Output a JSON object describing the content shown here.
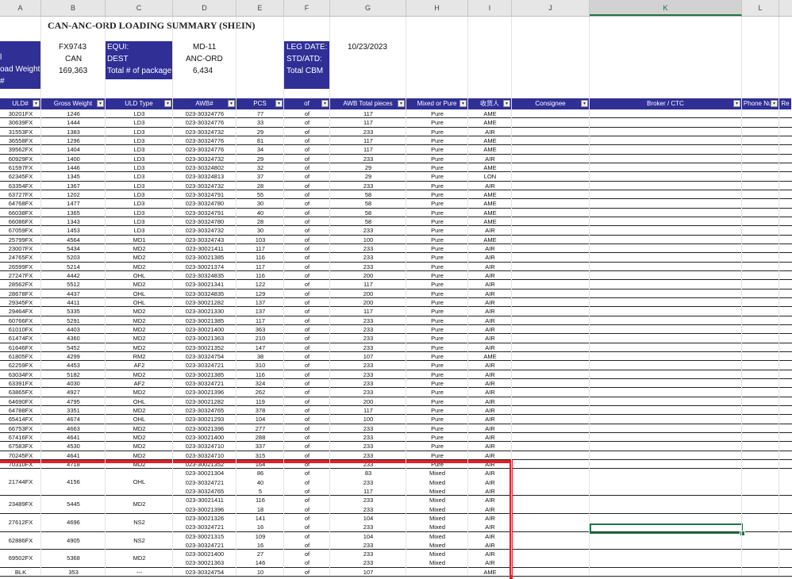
{
  "column_headers": [
    "A",
    "B",
    "C",
    "D",
    "E",
    "F",
    "G",
    "H",
    "I",
    "J",
    "K",
    "L"
  ],
  "selected_column": "K",
  "title": "CAN-ANC-ORD LOADING SUMMARY (SHEIN)",
  "header": {
    "flight": "FX9743",
    "equi_label": "EQUI:",
    "equi_value": "MD-11",
    "leg_date_label": "LEG DATE:",
    "leg_date_value": "10/23/2023",
    "origin": "CAN",
    "dest_label": "DEST",
    "dest_value": "ANC-ORD",
    "std_label": "STD/ATD:",
    "row3_label": "oad Weight:",
    "load_weight": "169,363",
    "total_pkg_label": "Total # of package",
    "total_pkg_value": "6,434",
    "total_cbm_label": "Total CBM",
    "row4_label": "#",
    "row1_label": "l"
  },
  "table_headers": [
    "ULD#",
    "Gross Weight",
    "ULD Type",
    "AWB#",
    "PCS",
    "of",
    "AWB Total pieces",
    "Mixed or Pure",
    "收货人",
    "Consignee",
    "Broker / CTC",
    "Phone Num",
    "Re"
  ],
  "rows": [
    [
      "30201FX",
      "1246",
      "LD3",
      "023-30324776",
      "77",
      "of",
      "117",
      "Pure",
      "AME"
    ],
    [
      "30639FX",
      "1444",
      "LD3",
      "023-30324776",
      "33",
      "of",
      "117",
      "Pure",
      "AME"
    ],
    [
      "31553FX",
      "1383",
      "LD3",
      "023-30324732",
      "29",
      "of",
      "233",
      "Pure",
      "AIR"
    ],
    [
      "36558FX",
      "1296",
      "LD3",
      "023-30324776",
      "81",
      "of",
      "117",
      "Pure",
      "AME"
    ],
    [
      "39562FX",
      "1404",
      "LD3",
      "023-30324776",
      "34",
      "of",
      "117",
      "Pure",
      "AME"
    ],
    [
      "60929FX",
      "1400",
      "LD3",
      "023-30324732",
      "29",
      "of",
      "233",
      "Pure",
      "AIR"
    ],
    [
      "61597FX",
      "1446",
      "LD3",
      "023-30324802",
      "32",
      "of",
      "29",
      "Pure",
      "AME"
    ],
    [
      "62345FX",
      "1345",
      "LD3",
      "023-30324813",
      "37",
      "of",
      "29",
      "Pure",
      "LON"
    ],
    [
      "63354FX",
      "1367",
      "LD3",
      "023-30324732",
      "28",
      "of",
      "233",
      "Pure",
      "AIR"
    ],
    [
      "63727FX",
      "1202",
      "LD3",
      "023-30324791",
      "55",
      "of",
      "58",
      "Pure",
      "AME"
    ],
    [
      "64768FX",
      "1477",
      "LD3",
      "023-30324780",
      "30",
      "of",
      "58",
      "Pure",
      "AME"
    ],
    [
      "66038FX",
      "1365",
      "LD3",
      "023-30324791",
      "40",
      "of",
      "58",
      "Pure",
      "AME"
    ],
    [
      "66086FX",
      "1343",
      "LD3",
      "023-30324780",
      "28",
      "of",
      "58",
      "Pure",
      "AME"
    ],
    [
      "67059FX",
      "1453",
      "LD3",
      "023-30324732",
      "30",
      "of",
      "233",
      "Pure",
      "AIR"
    ],
    [
      "25799FX",
      "4564",
      "MD1",
      "023-30324743",
      "103",
      "of",
      "100",
      "Pure",
      "AME"
    ],
    [
      "23007FX",
      "5434",
      "MD2",
      "023-30021411",
      "117",
      "of",
      "233",
      "Pure",
      "AIR"
    ],
    [
      "24765FX",
      "5203",
      "MD2",
      "023-30021385",
      "116",
      "of",
      "233",
      "Pure",
      "AIR"
    ],
    [
      "26599FX",
      "5214",
      "MD2",
      "023-30021374",
      "117",
      "of",
      "233",
      "Pure",
      "AIR"
    ],
    [
      "27247FX",
      "4442",
      "OHL",
      "023-30324835",
      "116",
      "of",
      "200",
      "Pure",
      "AIR"
    ],
    [
      "28562FX",
      "5512",
      "MD2",
      "023-30021341",
      "122",
      "of",
      "117",
      "Pure",
      "AIR"
    ],
    [
      "28678FX",
      "4437",
      "OHL",
      "023-30324835",
      "129",
      "of",
      "200",
      "Pure",
      "AIR"
    ],
    [
      "29345FX",
      "4411",
      "OHL",
      "023-30021282",
      "137",
      "of",
      "200",
      "Pure",
      "AIR"
    ],
    [
      "29464FX",
      "5335",
      "MD2",
      "023-30021330",
      "137",
      "of",
      "117",
      "Pure",
      "AIR"
    ],
    [
      "60766FX",
      "5291",
      "MD2",
      "023-30021385",
      "117",
      "of",
      "233",
      "Pure",
      "AIR"
    ],
    [
      "61010FX",
      "4403",
      "MD2",
      "023-30021400",
      "363",
      "of",
      "233",
      "Pure",
      "AIR"
    ],
    [
      "61474FX",
      "4360",
      "MD2",
      "023-30021363",
      "210",
      "of",
      "233",
      "Pure",
      "AIR"
    ],
    [
      "61646FX",
      "5452",
      "MD2",
      "023-30021352",
      "147",
      "of",
      "233",
      "Pure",
      "AIR"
    ],
    [
      "61805FX",
      "4299",
      "RM2",
      "023-30324754",
      "38",
      "of",
      "107",
      "Pure",
      "AME"
    ],
    [
      "62259FX",
      "4453",
      "AF2",
      "023-30324721",
      "310",
      "of",
      "233",
      "Pure",
      "AIR"
    ],
    [
      "63034FX",
      "5182",
      "MD2",
      "023-30021385",
      "116",
      "of",
      "233",
      "Pure",
      "AIR"
    ],
    [
      "63391FX",
      "4030",
      "AF2",
      "023-30324721",
      "324",
      "of",
      "233",
      "Pure",
      "AIR"
    ],
    [
      "63865FX",
      "4927",
      "MD2",
      "023-30021396",
      "262",
      "of",
      "233",
      "Pure",
      "AIR"
    ],
    [
      "64690FX",
      "4795",
      "OHL",
      "023-30021282",
      "119",
      "of",
      "200",
      "Pure",
      "AIR"
    ],
    [
      "64788FX",
      "3351",
      "MD2",
      "023-30324765",
      "378",
      "of",
      "117",
      "Pure",
      "AIR"
    ],
    [
      "65414FX",
      "4674",
      "OHL",
      "023-30021293",
      "104",
      "of",
      "100",
      "Pure",
      "AIR"
    ],
    [
      "66753FX",
      "4663",
      "MD2",
      "023-30021396",
      "277",
      "of",
      "233",
      "Pure",
      "AIR"
    ],
    [
      "67416FX",
      "4641",
      "MD2",
      "023-30021400",
      "288",
      "of",
      "233",
      "Pure",
      "AIR"
    ],
    [
      "67583FX",
      "4530",
      "MD2",
      "023-30324710",
      "337",
      "of",
      "233",
      "Pure",
      "AIR"
    ],
    [
      "70245FX",
      "4641",
      "MD2",
      "023-30324710",
      "315",
      "of",
      "233",
      "Pure",
      "AIR"
    ]
  ],
  "mixed_groups": [
    {
      "uld": "70310FX",
      "weight": "4718",
      "type": "MD2",
      "lines": [
        [
          "023-30021352",
          "164",
          "of",
          "233",
          "Pure",
          "AIR"
        ]
      ]
    },
    {
      "uld": "21744FX",
      "weight": "4156",
      "type": "OHL",
      "lines": [
        [
          "023-30021304",
          "86",
          "of",
          "83",
          "Mixed",
          "AIR"
        ],
        [
          "023-30324721",
          "40",
          "of",
          "233",
          "Mixed",
          "AIR"
        ],
        [
          "023-30324765",
          "5",
          "of",
          "117",
          "Mixed",
          "AIR"
        ]
      ]
    },
    {
      "uld": "23489FX",
      "weight": "5445",
      "type": "MD2",
      "lines": [
        [
          "023-30021411",
          "116",
          "of",
          "233",
          "Mixed",
          "AIR"
        ],
        [
          "023-30021396",
          "18",
          "of",
          "233",
          "Mixed",
          "AIR"
        ]
      ]
    },
    {
      "uld": "27612FX",
      "weight": "4696",
      "type": "NS2",
      "lines": [
        [
          "023-30021326",
          "141",
          "of",
          "104",
          "Mixed",
          "AIR"
        ],
        [
          "023-30324721",
          "16",
          "of",
          "233",
          "Mixed",
          "AIR"
        ]
      ]
    },
    {
      "uld": "62886FX",
      "weight": "4905",
      "type": "NS2",
      "lines": [
        [
          "023-30021315",
          "109",
          "of",
          "104",
          "Mixed",
          "AIR"
        ],
        [
          "023-30324721",
          "16",
          "of",
          "233",
          "Mixed",
          "AIR"
        ]
      ]
    },
    {
      "uld": "69502FX",
      "weight": "5368",
      "type": "MD2",
      "lines": [
        [
          "023-30021400",
          "27",
          "of",
          "233",
          "Mixed",
          "AIR"
        ],
        [
          "023-30021363",
          "146",
          "of",
          "233",
          "Mixed",
          "AIR"
        ]
      ]
    },
    {
      "uld": "BLK",
      "weight": "353",
      "type": "---",
      "lines": [
        [
          "023-30324754",
          "10",
          "of",
          "107",
          "",
          "AME"
        ]
      ]
    }
  ]
}
